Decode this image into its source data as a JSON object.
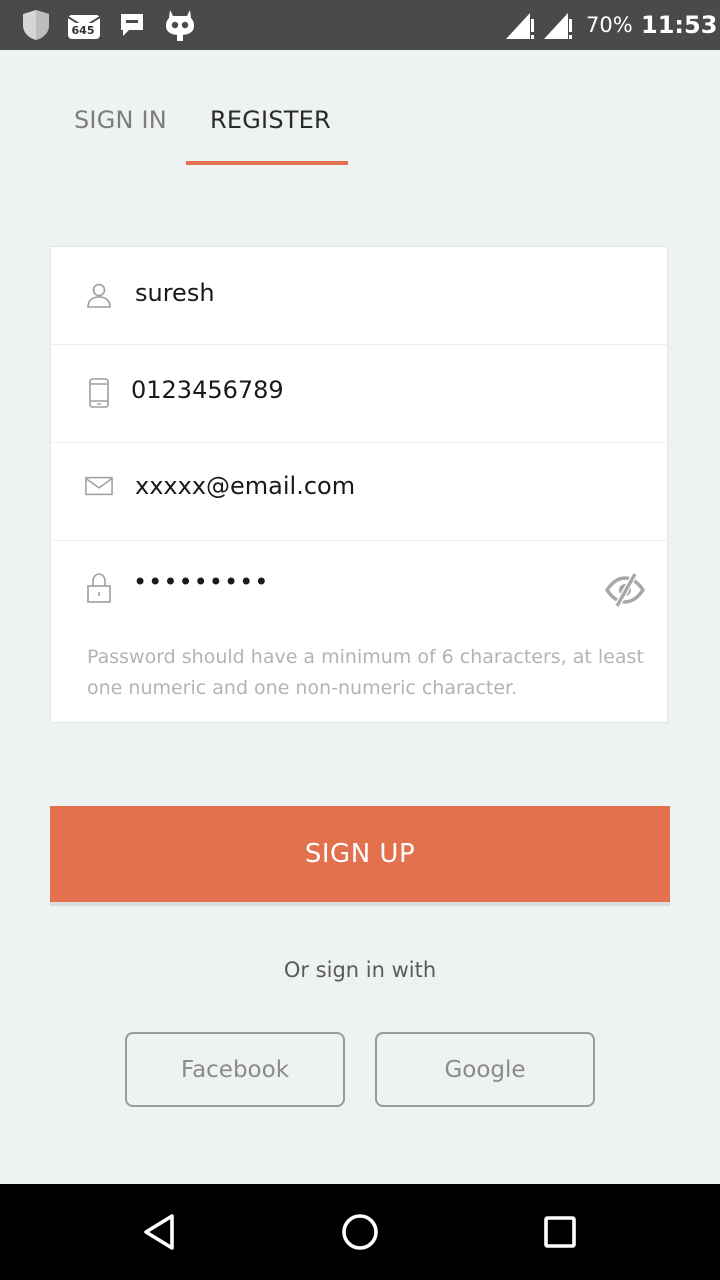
{
  "status_bar": {
    "icons": [
      "shield-icon",
      "notification-count-icon",
      "message-icon",
      "cyanogen-icon",
      "signal-icon",
      "signal-icon"
    ],
    "notification_count": "645",
    "battery": "70%",
    "time": "11:53"
  },
  "tabs": {
    "sign_in": "SIGN IN",
    "register": "REGISTER",
    "active": "register"
  },
  "form": {
    "name": {
      "icon": "user-icon",
      "value": "suresh"
    },
    "phone": {
      "icon": "phone-icon",
      "value": "0123456789"
    },
    "email": {
      "icon": "mail-icon",
      "value": "xxxxx@email.com"
    },
    "password": {
      "icon": "lock-icon",
      "value": "•••••••••",
      "toggle_icon": "eye-off-icon",
      "hint": "Password should have a minimum of 6 characters, at least one numeric and one non-numeric character."
    }
  },
  "signup_button": "SIGN UP",
  "social": {
    "prompt": "Or sign in with",
    "facebook": "Facebook",
    "google": "Google"
  },
  "nav_bar": {
    "icons": [
      "back-icon",
      "home-icon",
      "recents-icon"
    ]
  },
  "colors": {
    "accent": "#e4714d",
    "background": "#eff2f3",
    "status_bar": "#4a4a4a"
  }
}
